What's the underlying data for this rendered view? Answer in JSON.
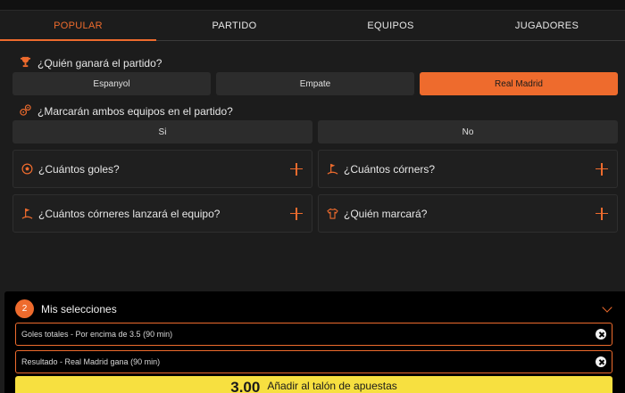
{
  "tabs": [
    "POPULAR",
    "PARTIDO",
    "EQUIPOS",
    "JUGADORES"
  ],
  "active_tab": "POPULAR",
  "accent_color": "#ee6b2d",
  "winner": {
    "question": "¿Quién ganará el partido?",
    "icon": "trophy-icon",
    "options": [
      "Espanyol",
      "Empate",
      "Real Madrid"
    ],
    "selected": "Real Madrid"
  },
  "btts": {
    "question": "¿Marcarán ambos equipos en el partido?",
    "icon": "balls-icon",
    "options": [
      "Si",
      "No"
    ]
  },
  "markets": [
    {
      "label": "¿Cuántos goles?",
      "icon": "soccer-ball-icon"
    },
    {
      "label": "¿Cuántos córners?",
      "icon": "corner-flag-icon"
    },
    {
      "label": "¿Cuántos córneres lanzará el equipo?",
      "icon": "corner-flag-icon"
    },
    {
      "label": "¿Quién marcará?",
      "icon": "shirt-icon"
    }
  ],
  "betslip": {
    "count": "2",
    "title": "Mis selecciones",
    "selections": [
      "Goles totales - Por encima de 3.5 (90 min)",
      "Resultado - Real Madrid gana (90 min)"
    ],
    "odds": "3.00",
    "button_label": "Añadir al talón de apuestas"
  }
}
